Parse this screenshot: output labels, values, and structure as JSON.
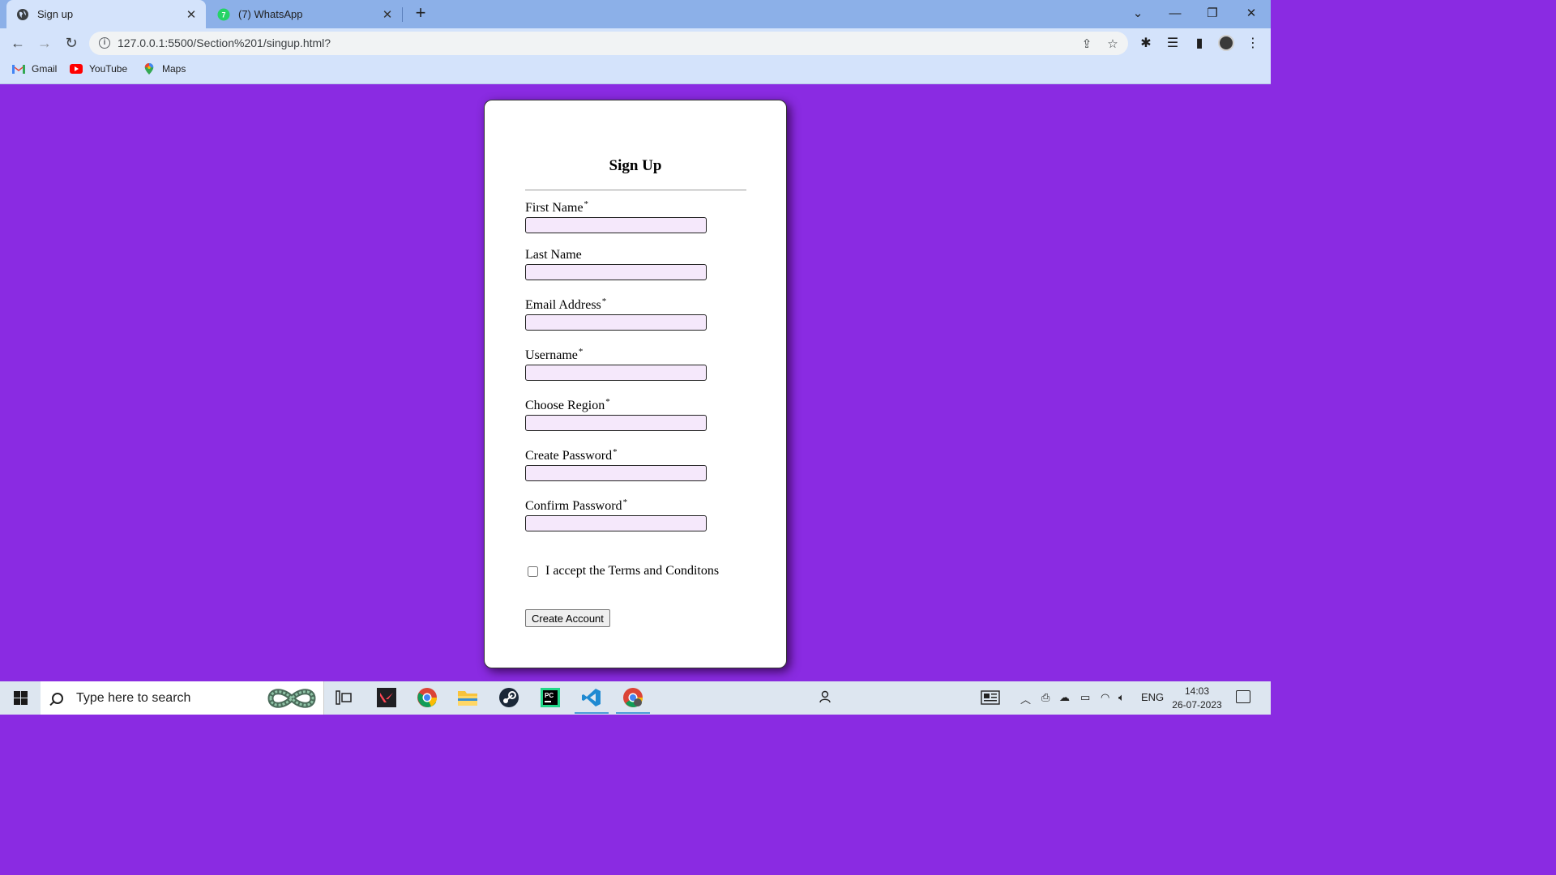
{
  "browser": {
    "tabs": [
      {
        "title": "Sign up",
        "active": true,
        "icon": "globe-icon"
      },
      {
        "title": "(7) WhatsApp",
        "active": false,
        "icon": "whatsapp-icon"
      }
    ],
    "new_tab_label": "+",
    "url": "127.0.0.1:5500/Section%201/singup.html?",
    "bookmarks": [
      {
        "label": "Gmail",
        "icon": "gmail-icon"
      },
      {
        "label": "YouTube",
        "icon": "youtube-icon"
      },
      {
        "label": "Maps",
        "icon": "maps-icon"
      }
    ]
  },
  "form": {
    "title": "Sign Up",
    "required_marker": "*",
    "fields": [
      {
        "label": "First Name",
        "required": true,
        "value": ""
      },
      {
        "label": "Last Name",
        "required": false,
        "value": ""
      },
      {
        "label": "Email Address",
        "required": true,
        "value": ""
      },
      {
        "label": "Username",
        "required": true,
        "value": ""
      },
      {
        "label": "Choose Region",
        "required": true,
        "value": ""
      },
      {
        "label": "Create Password",
        "required": true,
        "value": ""
      },
      {
        "label": "Confirm Password",
        "required": true,
        "value": ""
      }
    ],
    "terms_label": "I accept the Terms and Conditons",
    "terms_checked": false,
    "submit_label": "Create Account"
  },
  "taskbar": {
    "search_placeholder": "Type here to search",
    "language": "ENG",
    "time": "14:03",
    "date": "26-07-2023",
    "pinned_apps": [
      "task-view-icon",
      "valorant-icon",
      "chrome-icon",
      "file-explorer-icon",
      "steam-icon",
      "pycharm-icon",
      "vscode-icon",
      "chrome-profile-icon"
    ]
  },
  "colors": {
    "page_background": "#8a2be2",
    "input_background": "#f5e8fb",
    "tab_strip": "#8cb0e8",
    "toolbar": "#d4e3fb"
  }
}
